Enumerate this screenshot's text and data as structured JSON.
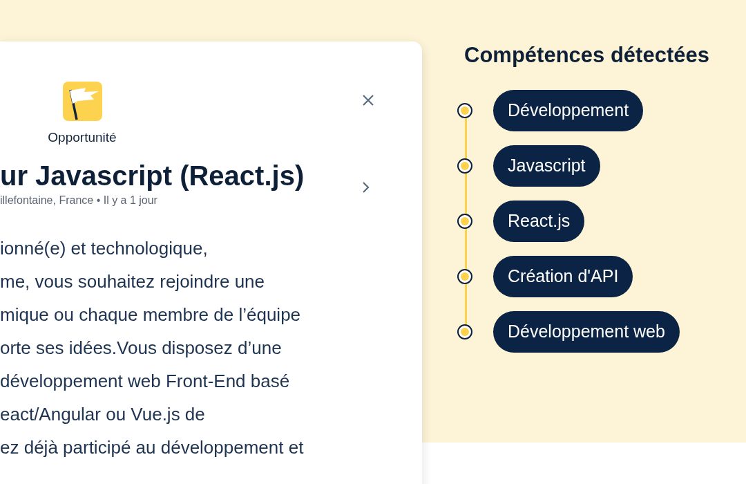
{
  "job_card": {
    "category": "Opportunité",
    "title": "ur Javascript (React.js)",
    "meta": "illefontaine, France • Il y a 1 jour",
    "description_lines": [
      "ionné(e) et technologique,",
      "me, vous souhaitez rejoindre une",
      "mique ou chaque membre de l’équipe",
      "orte ses idées.Vous disposez d’une",
      "développement web Front-End basé",
      "eact/Angular ou Vue.js de",
      "ez déjà participé au développement et"
    ]
  },
  "skills": {
    "title": "Compétences détectées",
    "items": [
      "Développement",
      "Javascript",
      "React.js",
      "Création d'API",
      "Développement web"
    ]
  }
}
